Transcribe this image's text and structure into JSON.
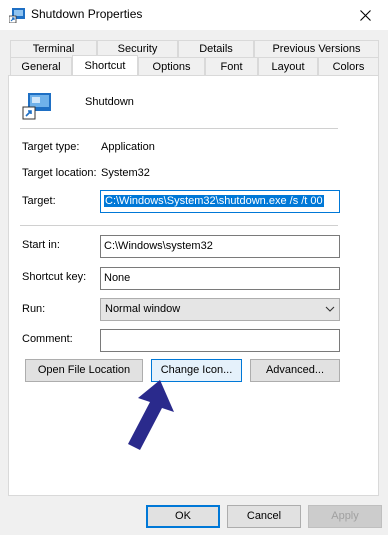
{
  "window": {
    "title": "Shutdown Properties"
  },
  "tabs_row1": [
    "Terminal",
    "Security",
    "Details",
    "Previous Versions"
  ],
  "tabs_row2": [
    "General",
    "Shortcut",
    "Options",
    "Font",
    "Layout",
    "Colors"
  ],
  "selected_tab": "Shortcut",
  "shortcut": {
    "name": "Shutdown",
    "target_type_label": "Target type:",
    "target_type_value": "Application",
    "target_location_label": "Target location:",
    "target_location_value": "System32",
    "target_label": "Target:",
    "target_value": "C:\\Windows\\System32\\shutdown.exe /s /t 00",
    "start_in_label": "Start in:",
    "start_in_value": "C:\\Windows\\system32",
    "shortcut_key_label": "Shortcut key:",
    "shortcut_key_value": "None",
    "run_label": "Run:",
    "run_value": "Normal window",
    "comment_label": "Comment:",
    "comment_value": ""
  },
  "buttons": {
    "open_file_location": "Open File Location",
    "change_icon": "Change Icon...",
    "advanced": "Advanced..."
  },
  "footer": {
    "ok": "OK",
    "cancel": "Cancel",
    "apply": "Apply"
  },
  "colors": {
    "accent": "#0078d7",
    "arrow": "#2a2a8c"
  },
  "icons": {
    "app": "shortcut-app-icon",
    "close": "close-icon",
    "combo": "chevron-down-icon",
    "pointer": "arrow-annotation-icon"
  }
}
